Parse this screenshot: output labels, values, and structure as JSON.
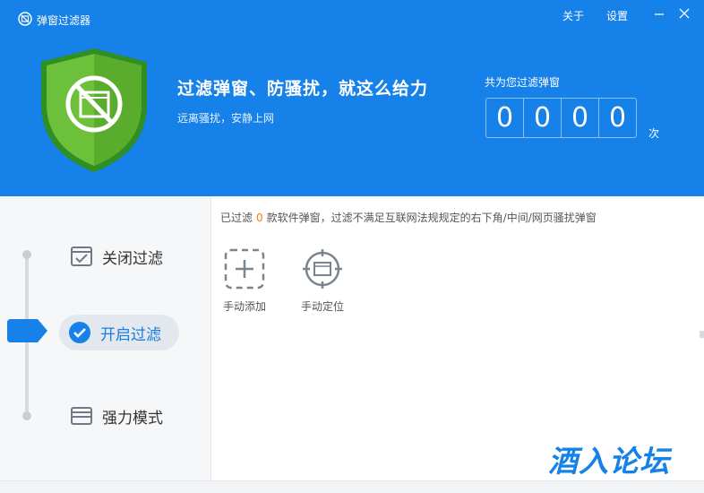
{
  "app": {
    "title": "弹窗过滤器"
  },
  "topbar": {
    "about_label": "关于",
    "settings_label": "设置"
  },
  "hero": {
    "headline": "过滤弹窗、防骚扰，就这么给力",
    "subline": "远离骚扰，安静上网",
    "counter_label": "共为您过滤弹窗",
    "digits": [
      "0",
      "0",
      "0",
      "0"
    ],
    "counter_unit": "次"
  },
  "modes": [
    {
      "label": "关闭过滤",
      "icon": "browser-check-icon"
    },
    {
      "label": "开启过滤",
      "icon": "checkmark-circle-icon"
    },
    {
      "label": "强力模式",
      "icon": "window-stack-icon"
    }
  ],
  "active_mode": "开启过滤",
  "info": {
    "prefix": "已过滤",
    "count": "0",
    "suffix": "款软件弹窗，过滤不满足互联网法规规定的右下角/中间/网页骚扰弹窗"
  },
  "tools": [
    {
      "label": "手动添加",
      "icon": "dashed-plus-icon"
    },
    {
      "label": "手动定位",
      "icon": "crosshair-window-icon"
    }
  ],
  "watermark": "酒入论坛",
  "colors": {
    "accent": "#1681e8",
    "shield_green": "#5db530",
    "highlight_orange": "#ff7a00"
  }
}
